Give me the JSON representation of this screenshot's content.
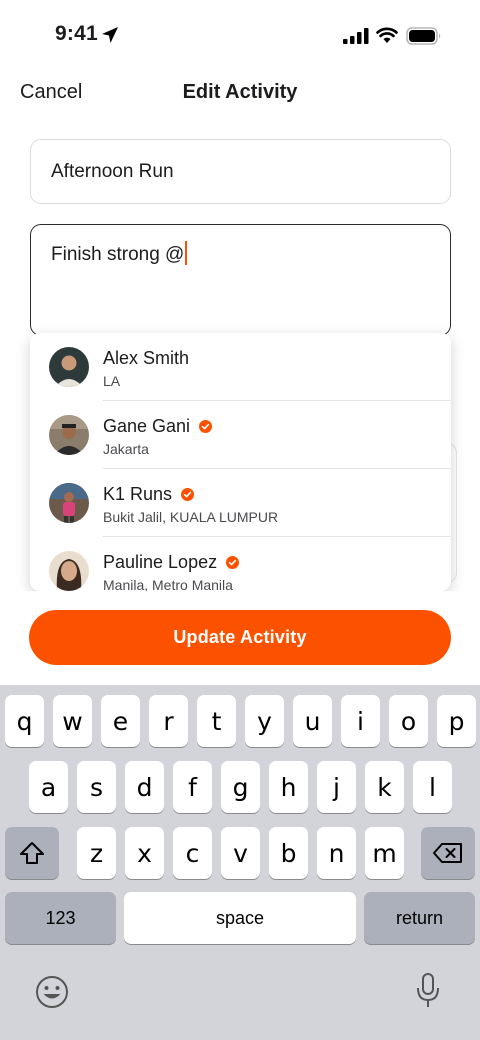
{
  "status_bar": {
    "time": "9:41"
  },
  "nav": {
    "cancel_label": "Cancel",
    "title": "Edit Activity"
  },
  "form": {
    "title_value": "Afternoon Run",
    "description_value": "Finish strong @"
  },
  "mentions": [
    {
      "name": "Alex Smith",
      "location": "LA",
      "verified": false
    },
    {
      "name": "Gane Gani",
      "location": "Jakarta",
      "verified": true
    },
    {
      "name": "K1 Runs",
      "location": "Bukit Jalil, KUALA LUMPUR",
      "verified": true
    },
    {
      "name": "Pauline Lopez",
      "location": "Manila, Metro Manila",
      "verified": true
    }
  ],
  "update_button_label": "Update Activity",
  "keyboard": {
    "row1": [
      "q",
      "w",
      "e",
      "r",
      "t",
      "y",
      "u",
      "i",
      "o",
      "p"
    ],
    "row2": [
      "a",
      "s",
      "d",
      "f",
      "g",
      "h",
      "j",
      "k",
      "l"
    ],
    "row3": [
      "z",
      "x",
      "c",
      "v",
      "b",
      "n",
      "m"
    ],
    "numbers_label": "123",
    "space_label": "space",
    "return_label": "return"
  },
  "colors": {
    "accent": "#fc5200",
    "keyboard_bg": "#d2d4da"
  },
  "icons": [
    "location-arrow-icon",
    "cellular-signal-icon",
    "wifi-icon",
    "battery-icon",
    "verified-badge-icon",
    "shift-icon",
    "delete-icon",
    "emoji-icon",
    "microphone-icon"
  ]
}
